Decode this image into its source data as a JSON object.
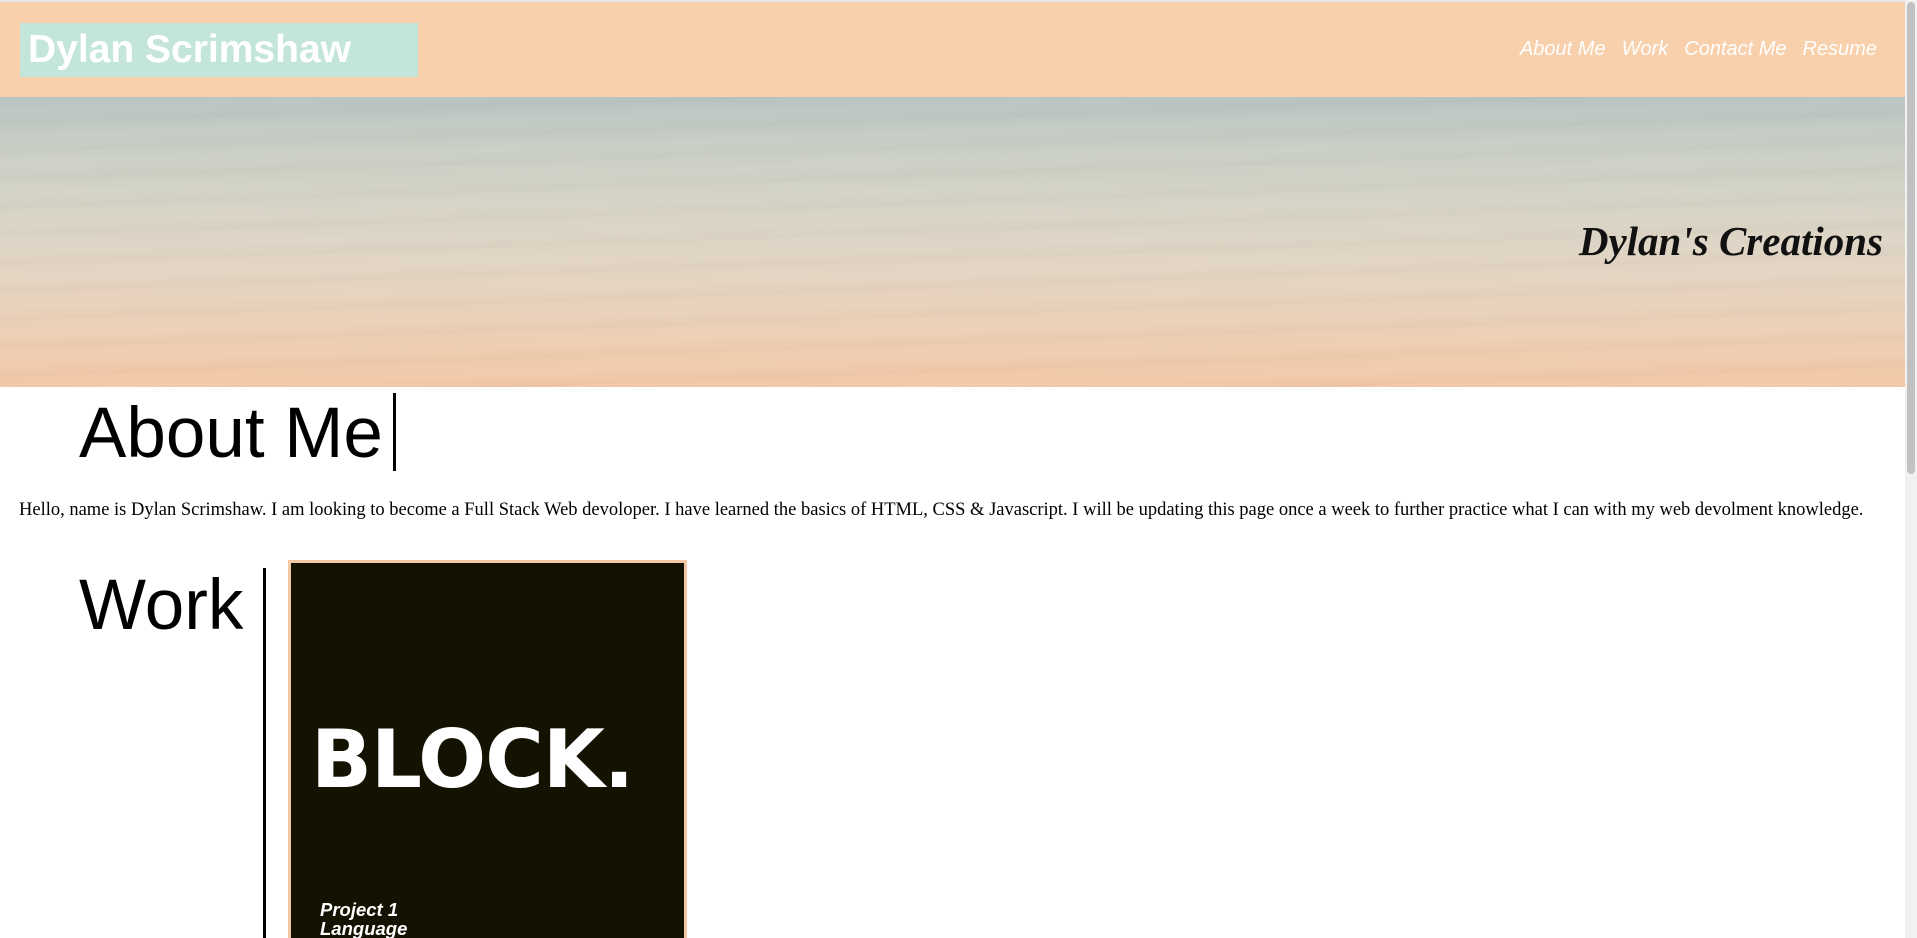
{
  "header": {
    "site_title": "Dylan Scrimshaw",
    "nav": [
      "About Me",
      "Work",
      "Contact Me",
      "Resume"
    ]
  },
  "hero": {
    "title": "Dylan's Creations"
  },
  "about": {
    "heading": "About Me",
    "text": "Hello, name is Dylan Scrimshaw. I am looking to become a Full Stack Web devoloper. I have learned the basics of HTML, CSS & Javascript. I will be updating this page once a week to further practice what I can with my web devolment knowledge."
  },
  "work": {
    "heading": "Work",
    "projects": [
      {
        "logo_text": "BLOCK.",
        "caption_line1": "Project 1",
        "caption_line2": "Language"
      }
    ]
  },
  "colors": {
    "header_bg": "#f8d0ac",
    "logo_bg": "#c4e5dc",
    "card_bg": "#141200",
    "card_border": "#f3c9a3"
  }
}
